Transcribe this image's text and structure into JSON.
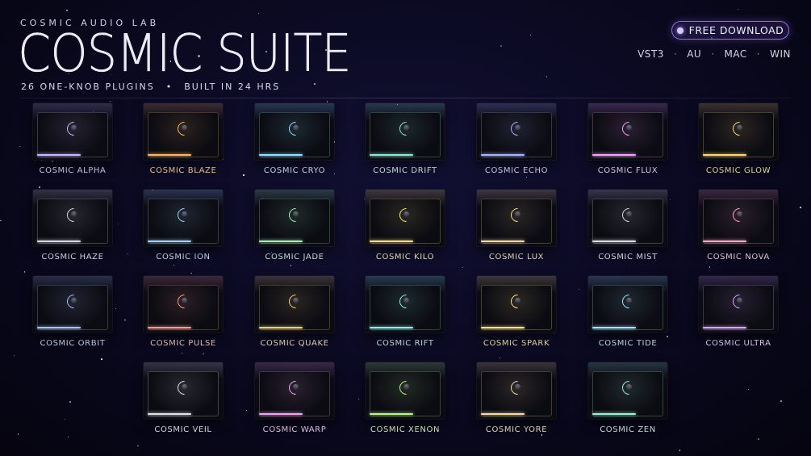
{
  "header": {
    "brand": "COSMIC AUDIO LAB",
    "title": "COSMIC SUITE",
    "tagline_left": "26 ONE-KNOB PLUGINS",
    "tagline_sep": "•",
    "tagline_right": "BUILT IN 24 HRS"
  },
  "download": {
    "label": "FREE DOWNLOAD"
  },
  "formats": [
    "VST3",
    "AU",
    "MAC",
    "WIN"
  ],
  "format_sep": "·",
  "plugins": [
    {
      "name": "COSMIC ALPHA",
      "accent": "#c7b8ff",
      "label_color": "#d6d3f2"
    },
    {
      "name": "COSMIC BLAZE",
      "accent": "#ffb46a",
      "label_color": "#ffcf9f"
    },
    {
      "name": "COSMIC CRYO",
      "accent": "#8fe3ff",
      "label_color": "#cde7f2"
    },
    {
      "name": "COSMIC DRIFT",
      "accent": "#8fe8d6",
      "label_color": "#cfeee6"
    },
    {
      "name": "COSMIC ECHO",
      "accent": "#a9b6ff",
      "label_color": "#d7dcf5"
    },
    {
      "name": "COSMIC FLUX",
      "accent": "#f0a6ff",
      "label_color": "#f0d8f4"
    },
    {
      "name": "COSMIC GLOW",
      "accent": "#ffd77a",
      "label_color": "#f2e1a6"
    },
    {
      "name": "COSMIC HAZE",
      "accent": "#d8d8e4",
      "label_color": "#e3e3ec"
    },
    {
      "name": "COSMIC ION",
      "accent": "#9fd4ff",
      "label_color": "#cde3f6"
    },
    {
      "name": "COSMIC JADE",
      "accent": "#9ff0b8",
      "label_color": "#d3f1dd"
    },
    {
      "name": "COSMIC KILO",
      "accent": "#f7e27e",
      "label_color": "#f4ebb8"
    },
    {
      "name": "COSMIC LUX",
      "accent": "#f3dc93",
      "label_color": "#f3e6c2"
    },
    {
      "name": "COSMIC MIST",
      "accent": "#d9dbe5",
      "label_color": "#e6e6ee"
    },
    {
      "name": "COSMIC NOVA",
      "accent": "#ffa7c8",
      "label_color": "#f4d3df"
    },
    {
      "name": "COSMIC ORBIT",
      "accent": "#a8c2ff",
      "label_color": "#d2dcf4"
    },
    {
      "name": "COSMIC PULSE",
      "accent": "#ff9e8f",
      "label_color": "#f2c9c1"
    },
    {
      "name": "COSMIC QUAKE",
      "accent": "#f5cf80",
      "label_color": "#f1e2bd"
    },
    {
      "name": "COSMIC RIFT",
      "accent": "#8ff0e8",
      "label_color": "#cdebea"
    },
    {
      "name": "COSMIC SPARK",
      "accent": "#fbe48a",
      "label_color": "#f4e6ad"
    },
    {
      "name": "COSMIC TIDE",
      "accent": "#9fe6ff",
      "label_color": "#d2e9f2"
    },
    {
      "name": "COSMIC ULTRA",
      "accent": "#d7a6ff",
      "label_color": "#e6d4f6"
    },
    {
      "name": "COSMIC VEIL",
      "accent": "#e4e4ee",
      "label_color": "#e9e9f1"
    },
    {
      "name": "COSMIC WARP",
      "accent": "#f0a6f0",
      "label_color": "#efcdef"
    },
    {
      "name": "COSMIC XENON",
      "accent": "#b8f78e",
      "label_color": "#ddf3c8"
    },
    {
      "name": "COSMIC YORE",
      "accent": "#f7dca6",
      "label_color": "#f3e5c9"
    },
    {
      "name": "COSMIC ZEN",
      "accent": "#9ff0d4",
      "label_color": "#d1efe4"
    }
  ]
}
